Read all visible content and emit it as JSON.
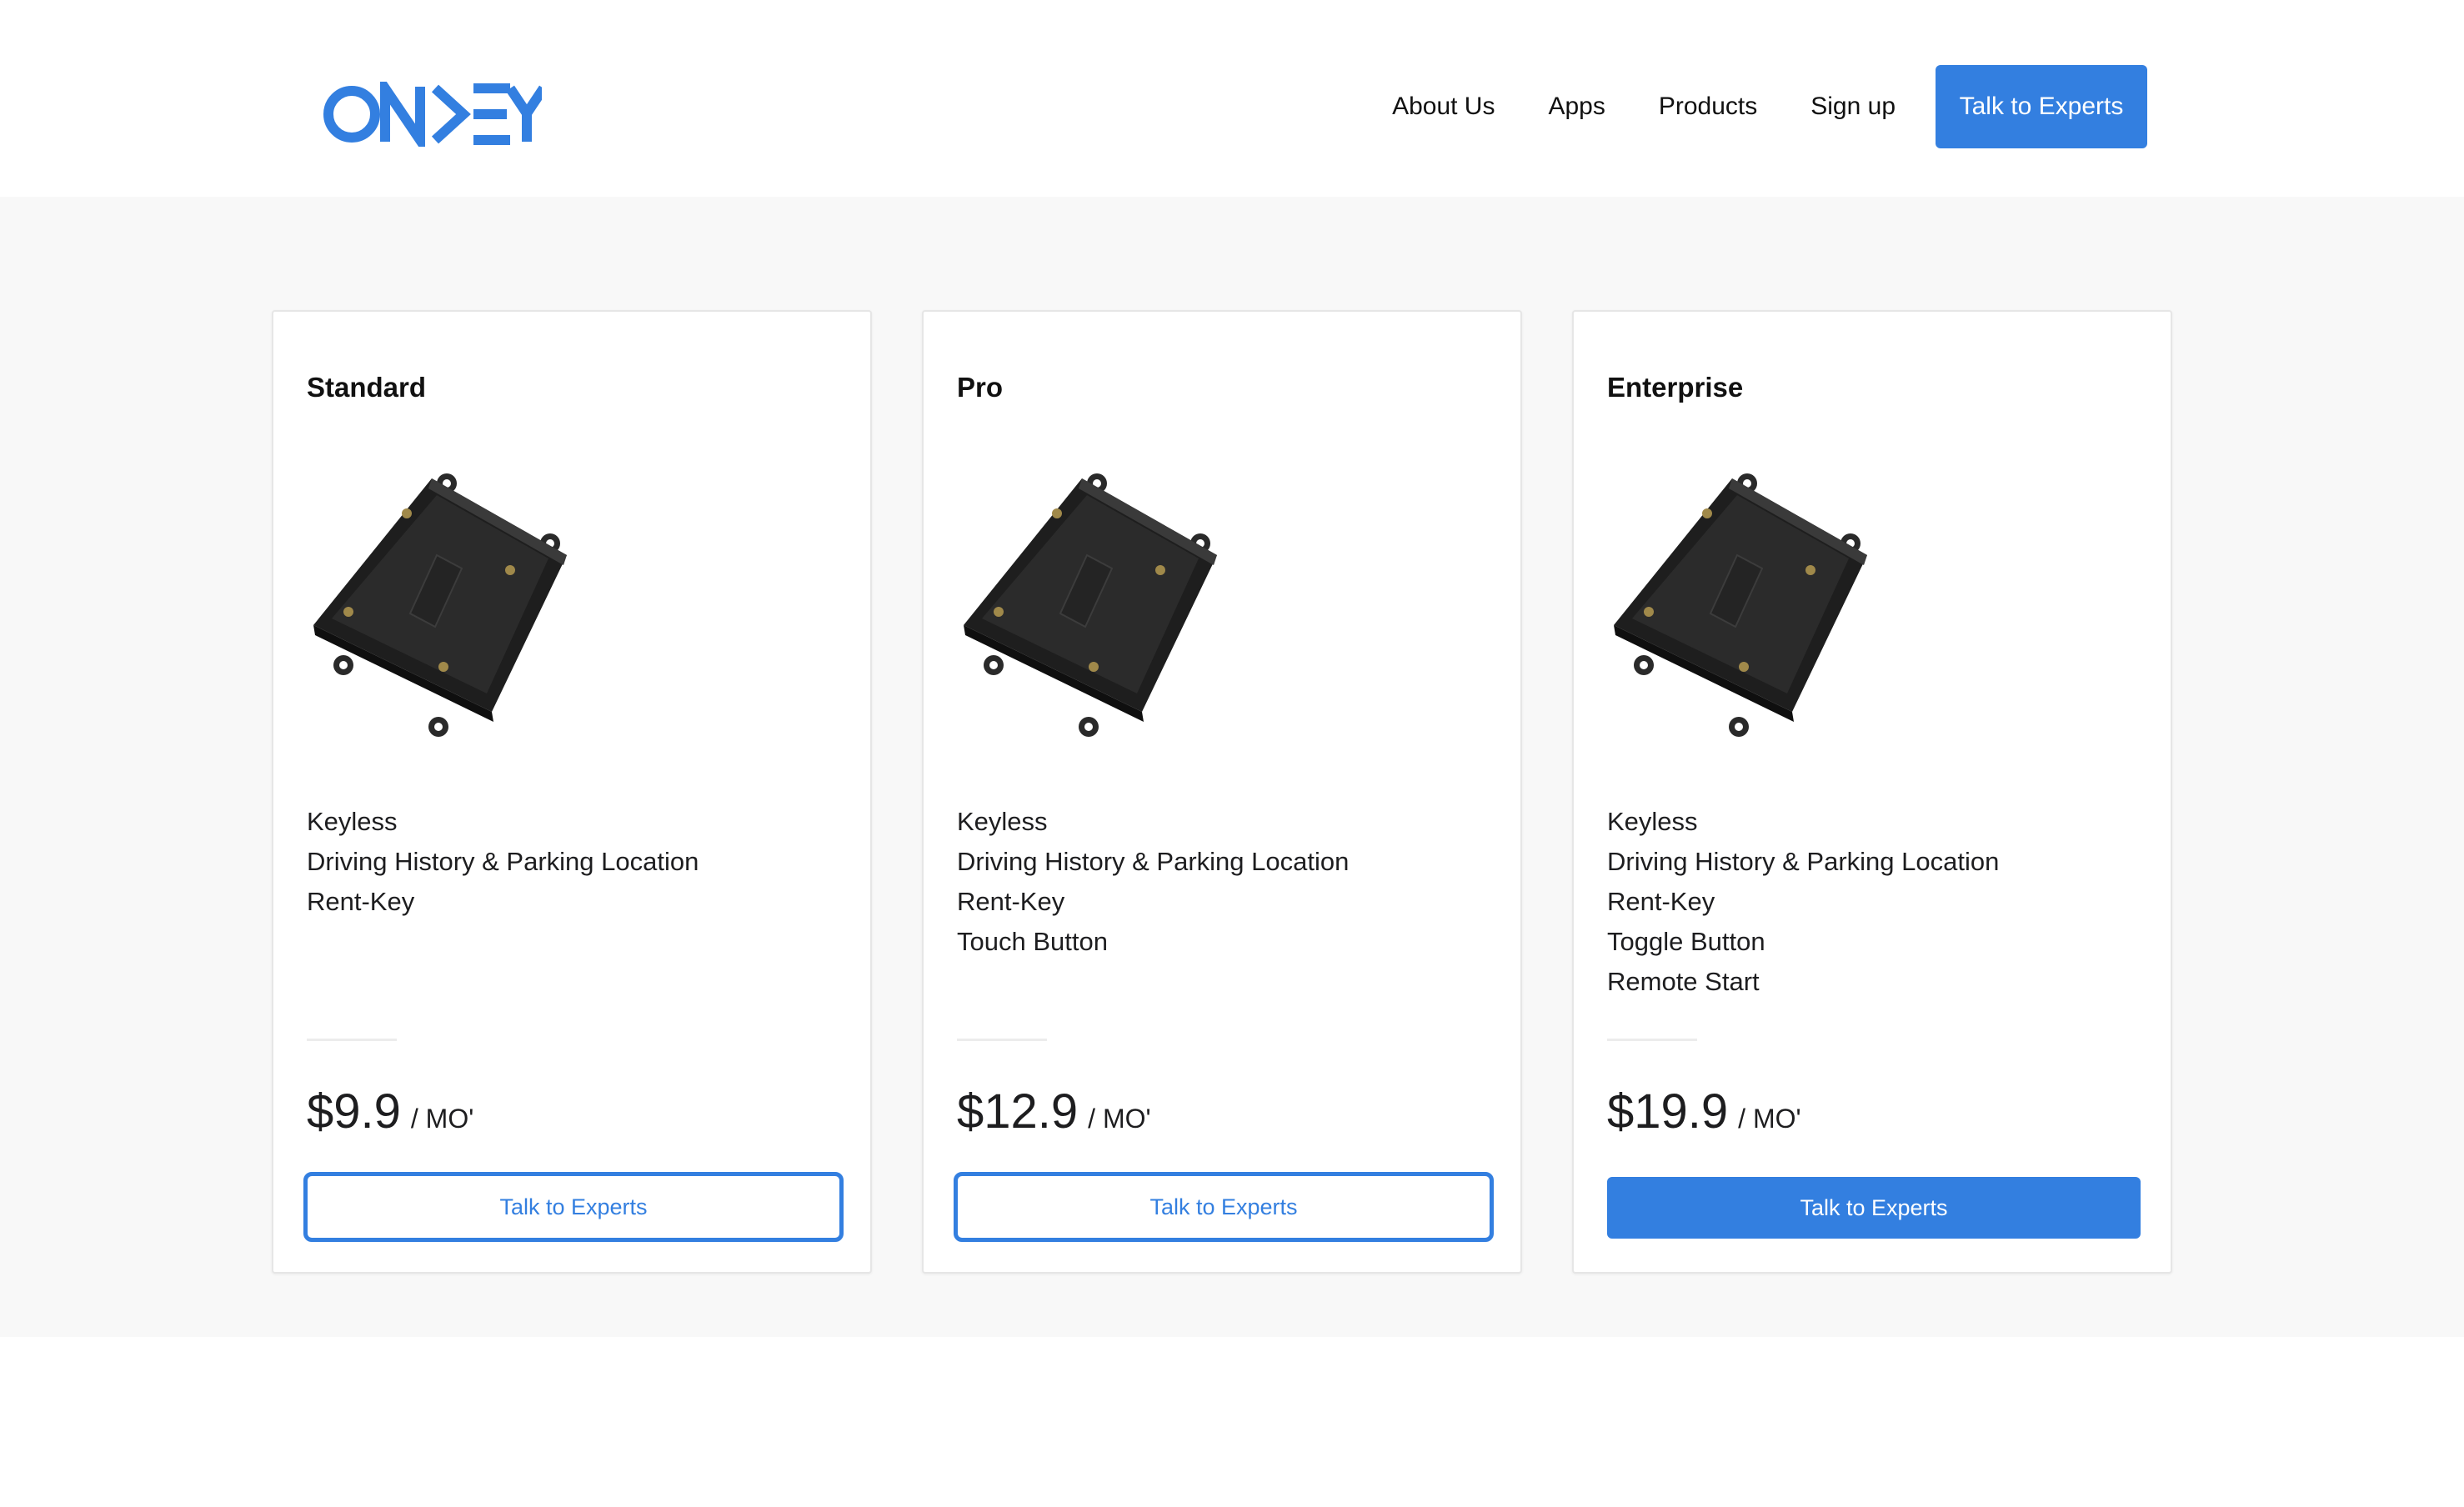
{
  "brand": {
    "logo_text": "ONKEY",
    "accent_color": "#337fe0"
  },
  "nav": {
    "items": [
      "About Us",
      "Apps",
      "Products",
      "Sign up"
    ],
    "cta_label": "Talk to Experts"
  },
  "plans": [
    {
      "name": "Standard",
      "image_icon": "onkey-device-image",
      "features": [
        "Keyless",
        "Driving History & Parking Location",
        "Rent-Key"
      ],
      "price": "$9.9",
      "period": "/ MO'",
      "button_label": "Talk to Experts",
      "button_style": "outline"
    },
    {
      "name": "Pro",
      "image_icon": "onkey-device-image",
      "features": [
        "Keyless",
        "Driving History & Parking Location",
        "Rent-Key",
        "Touch Button"
      ],
      "price": "$12.9",
      "period": "/ MO'",
      "button_label": "Talk to Experts",
      "button_style": "outline"
    },
    {
      "name": "Enterprise",
      "image_icon": "onkey-device-image",
      "features": [
        "Keyless",
        "Driving History & Parking Location",
        "Rent-Key",
        "Toggle Button",
        "Remote Start"
      ],
      "price": "$19.9",
      "period": "/ MO'",
      "button_label": "Talk to Experts",
      "button_style": "solid"
    }
  ]
}
